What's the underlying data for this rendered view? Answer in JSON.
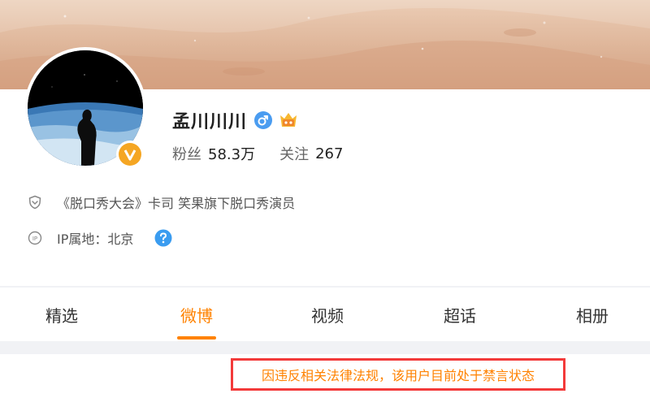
{
  "profile": {
    "name": "孟川川川",
    "fans_label": "粉丝",
    "fans_value": "58.3万",
    "following_label": "关注",
    "following_value": "267",
    "certification": "《脱口秀大会》卡司 笑果旗下脱口秀演员",
    "ip_location": "IP属地：北京"
  },
  "icons": {
    "gender": "male-icon",
    "member": "vip-member-icon",
    "verified": "verified-v-badge",
    "certification": "shield-icon",
    "ip": "ip-icon",
    "help": "help-icon"
  },
  "tabs": [
    {
      "label": "精选",
      "active": false
    },
    {
      "label": "微博",
      "active": true
    },
    {
      "label": "视频",
      "active": false
    },
    {
      "label": "超话",
      "active": false
    },
    {
      "label": "相册",
      "active": false
    }
  ],
  "notice": {
    "text": "因违反相关法律法规，该用户目前处于禁言状态"
  },
  "colors": {
    "accent": "#ff8200",
    "notice_border": "#f33a3a",
    "gender_icon": "#4a9cf0",
    "verified_badge": "#f5a623",
    "help_icon": "#3a9cf0"
  }
}
